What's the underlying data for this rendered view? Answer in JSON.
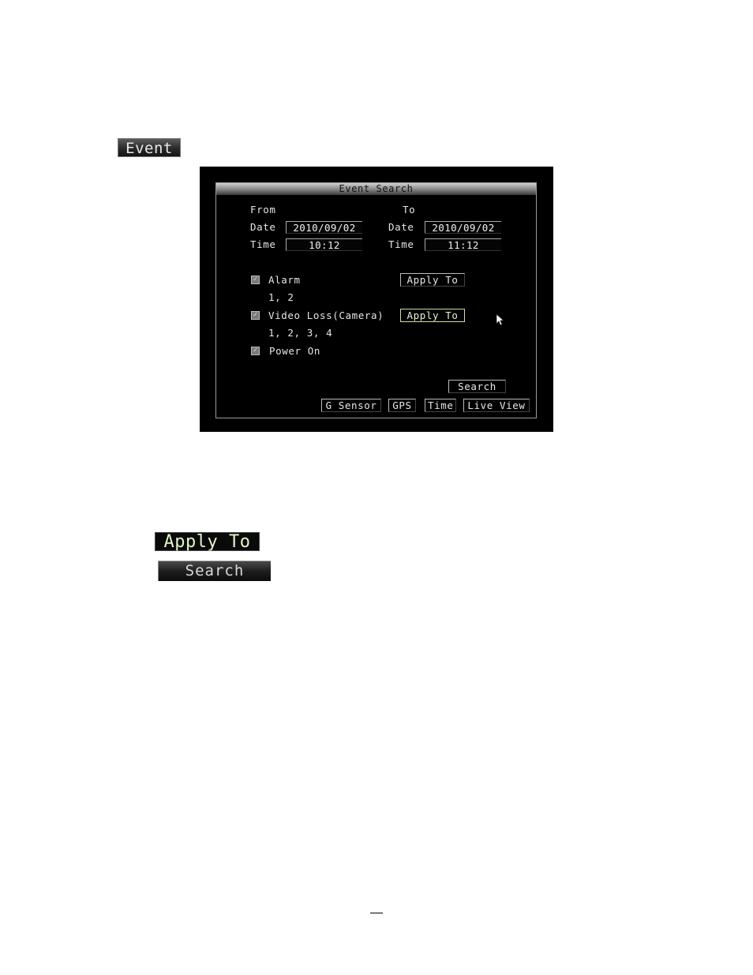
{
  "event_chip": {
    "label": "Event"
  },
  "dvr": {
    "title": "Event Search",
    "from_label": "From",
    "to_label": "To",
    "from_date_label": "Date",
    "from_date": "2010/09/02",
    "from_time_label": "Time",
    "from_time": "10:12",
    "to_date_label": "Date",
    "to_date": "2010/09/02",
    "to_time_label": "Time",
    "to_time": "11:12",
    "alarm_label": "Alarm",
    "alarm_channels": "1, 2",
    "alarm_apply": "Apply To",
    "video_loss_label": "Video Loss(Camera)",
    "video_loss_channels": "1, 2, 3, 4",
    "video_loss_apply": "Apply To",
    "power_on_label": "Power On",
    "search_button": "Search",
    "tabs": [
      "G Sensor",
      "GPS",
      "Time",
      "Live View"
    ]
  },
  "samples": {
    "apply_to": "Apply To",
    "search": "Search"
  }
}
